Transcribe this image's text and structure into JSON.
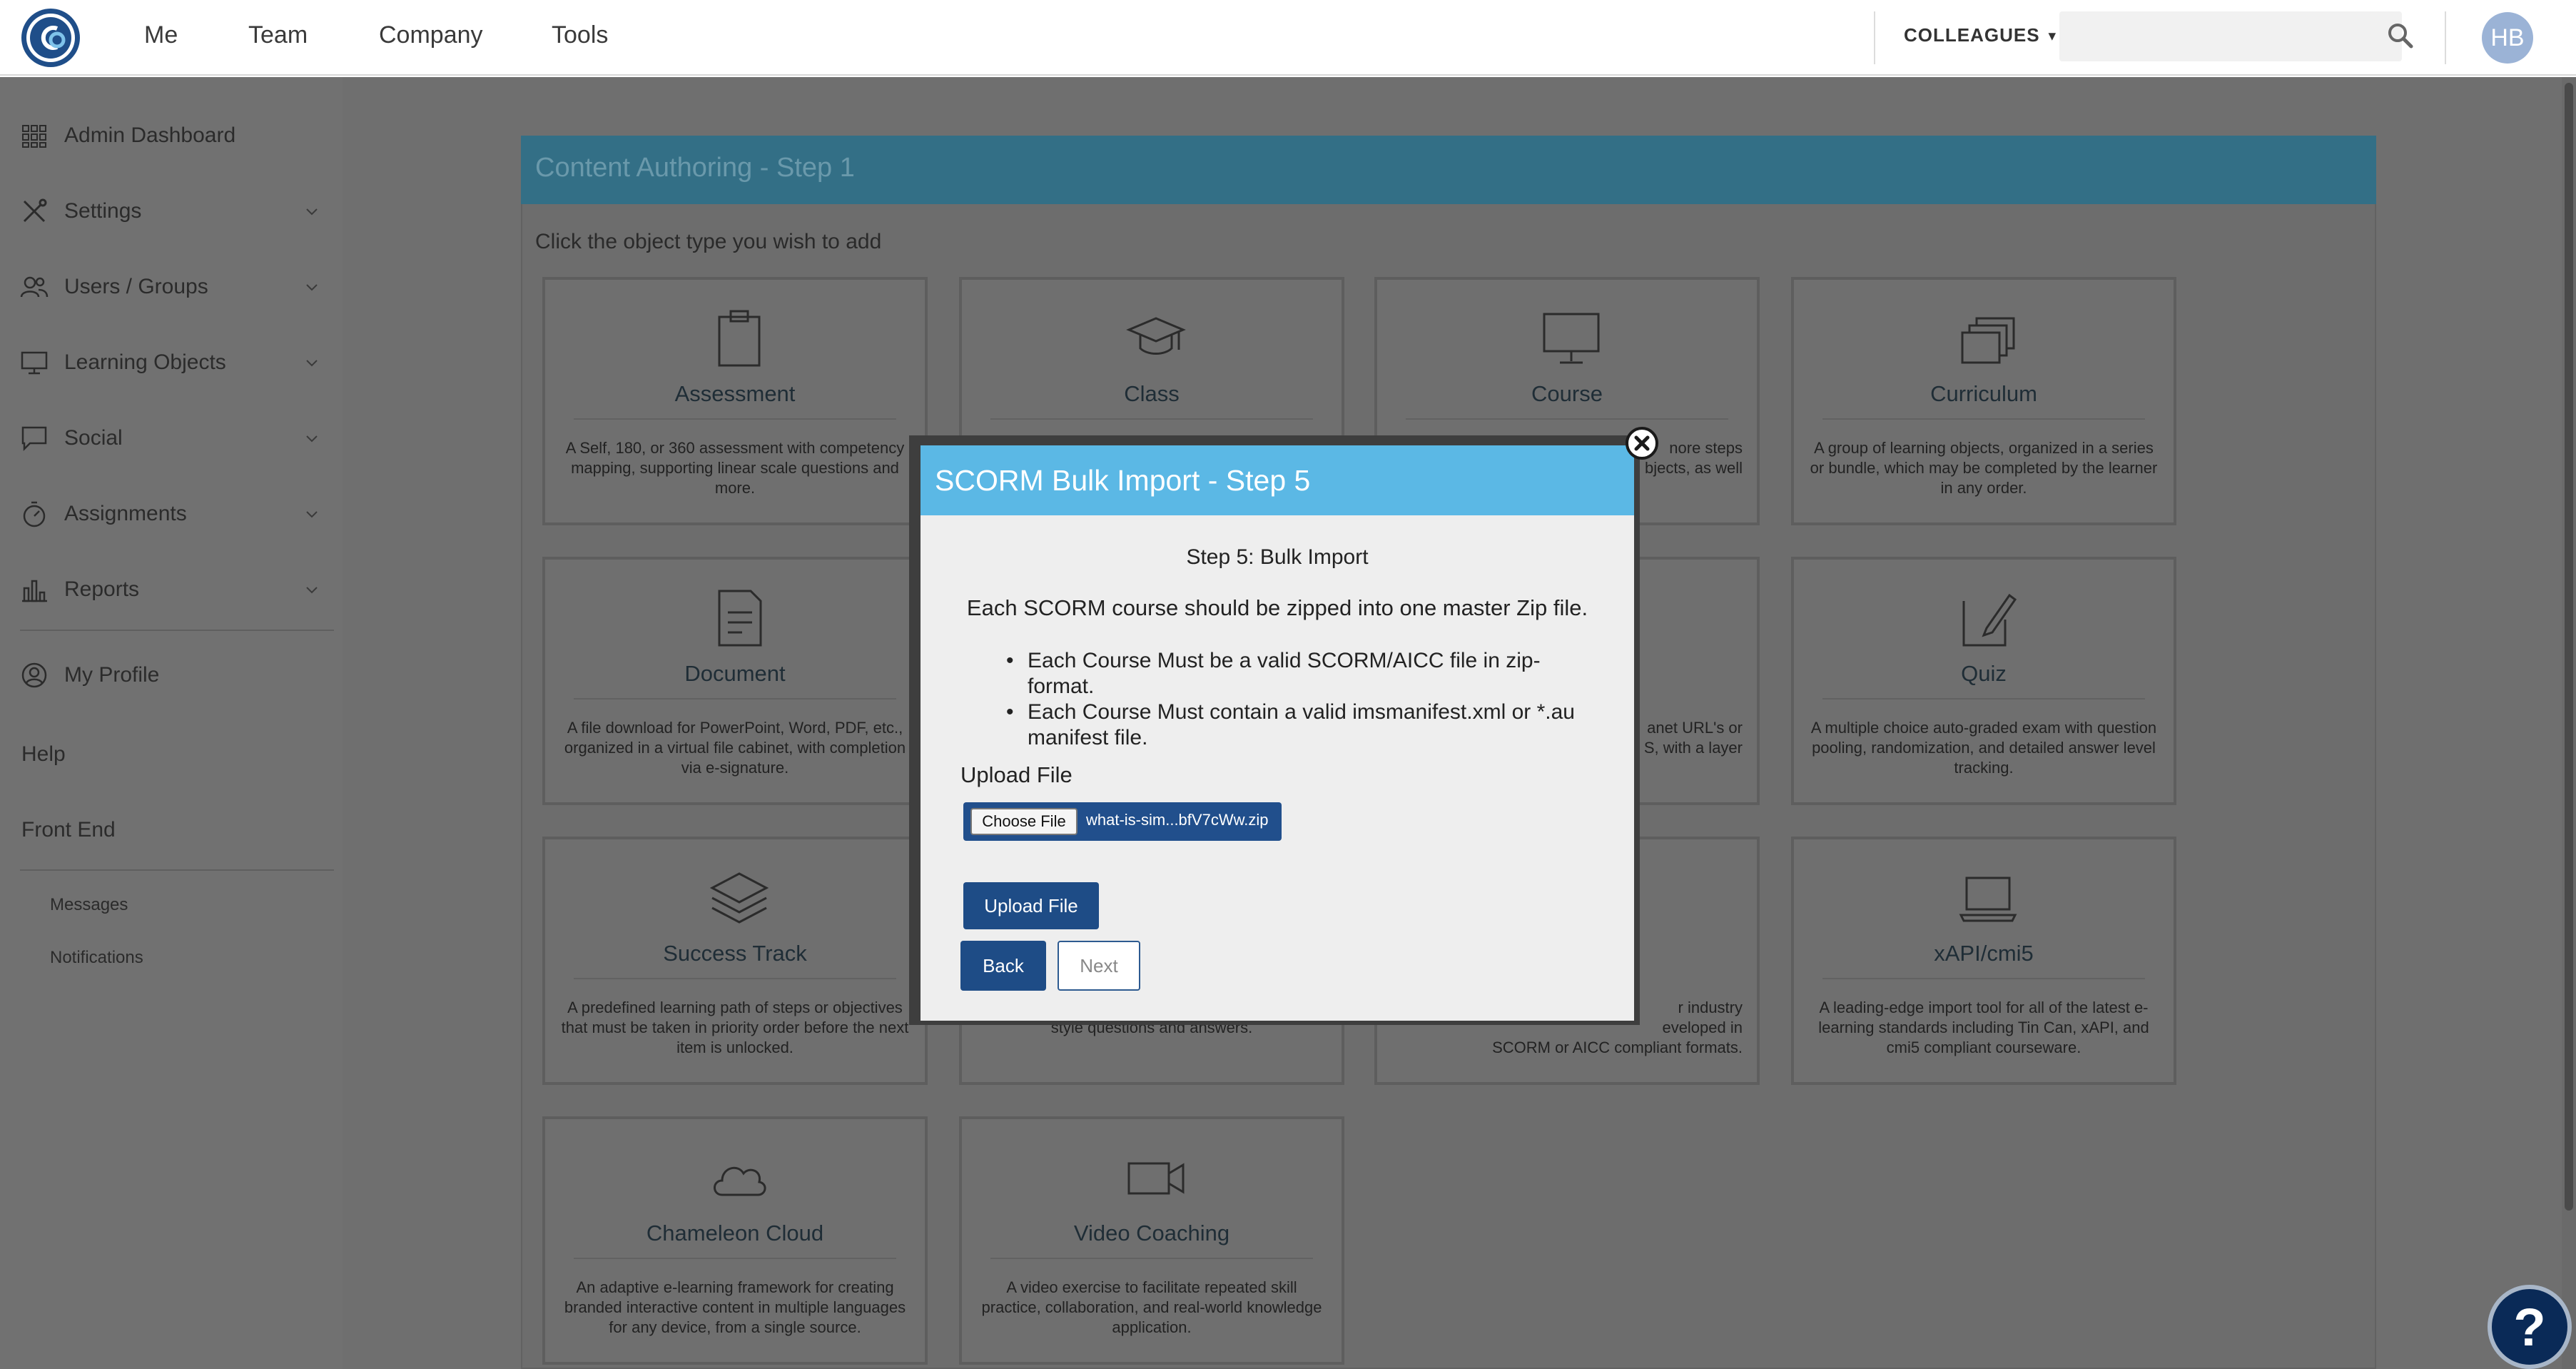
{
  "nav": {
    "items": [
      "Me",
      "Team",
      "Company",
      "Tools"
    ],
    "colleagues_label": "COLLEAGUES",
    "search_placeholder": "",
    "avatar_initials": "HB"
  },
  "sidebar": {
    "items": [
      {
        "label": "Admin Dashboard",
        "icon": "grid-icon"
      },
      {
        "label": "Settings",
        "icon": "tools-icon"
      },
      {
        "label": "Users / Groups",
        "icon": "users-icon"
      },
      {
        "label": "Learning Objects",
        "icon": "monitor-icon"
      },
      {
        "label": "Social",
        "icon": "chat-icon"
      },
      {
        "label": "Assignments",
        "icon": "stopwatch-icon"
      },
      {
        "label": "Reports",
        "icon": "bar-chart-icon"
      }
    ],
    "profile_label": "My Profile",
    "help_label": "Help",
    "frontend_label": "Front End",
    "messages_label": "Messages",
    "notifications_label": "Notifications"
  },
  "content": {
    "title": "Content Authoring - Step 1",
    "instruction": "Click the object type you wish to add",
    "cards": [
      {
        "title": "Assessment",
        "desc": "A Self, 180, or 360 assessment with competency mapping, supporting linear scale questions and more.",
        "icon": "clipboard-icon"
      },
      {
        "title": "Class",
        "desc": "",
        "icon": "graduation-cap-icon"
      },
      {
        "title": "Course",
        "desc": "nore steps\nbjects, as well",
        "icon": "monitor-icon"
      },
      {
        "title": "Curriculum",
        "desc": "A group of learning objects, organized in a series or bundle, which may be completed by the learner in any order.",
        "icon": "stack-icon"
      },
      {
        "title": "Document",
        "desc": "A file download for PowerPoint, Word, PDF, etc., organized in a virtual file cabinet, with completion via e-signature.",
        "icon": "document-icon"
      },
      {
        "title": "",
        "desc": "",
        "icon": ""
      },
      {
        "title": "",
        "desc": "anet URL's or\nS, with a layer",
        "icon": ""
      },
      {
        "title": "Quiz",
        "desc": "A multiple choice auto-graded exam with question pooling, randomization, and detailed answer level tracking.",
        "icon": "pencil-note-icon"
      },
      {
        "title": "Success Track",
        "desc": "A predefined learning path of steps or objectives that must be taken in priority order before the next item is unlocked.",
        "icon": "layers-icon"
      },
      {
        "title": "",
        "desc": "style questions and answers.",
        "icon": ""
      },
      {
        "title": "",
        "desc": "r industry\neveloped in\nSCORM or AICC compliant formats.",
        "icon": ""
      },
      {
        "title": "xAPI/cmi5",
        "desc": "A leading-edge import tool for all of the latest e-learning standards including Tin Can, xAPI, and cmi5 compliant courseware.",
        "icon": "laptop-icon"
      },
      {
        "title": "Chameleon Cloud",
        "desc": "An adaptive e-learning framework for creating branded interactive content in multiple languages for any device, from a single source.",
        "icon": "cloud-icon"
      },
      {
        "title": "Video Coaching",
        "desc": "A video exercise to facilitate repeated skill practice, collaboration, and real-world knowledge application.",
        "icon": "video-camera-icon"
      }
    ]
  },
  "modal": {
    "title": "SCORM Bulk Import - Step 5",
    "step_label": "Step 5: Bulk Import",
    "description": "Each SCORM course should be zipped into one master Zip file.",
    "bullets": [
      "Each Course Must be a valid SCORM/AICC file in zip-format.",
      "Each Course Must contain a valid imsmanifest.xml or *.au manifest file."
    ],
    "upload_label": "Upload File",
    "choose_file_label": "Choose File",
    "file_name": "what-is-sim...bfV7cWw.zip",
    "upload_button": "Upload File",
    "back_button": "Back",
    "next_button": "Next"
  },
  "help_button": "?"
}
